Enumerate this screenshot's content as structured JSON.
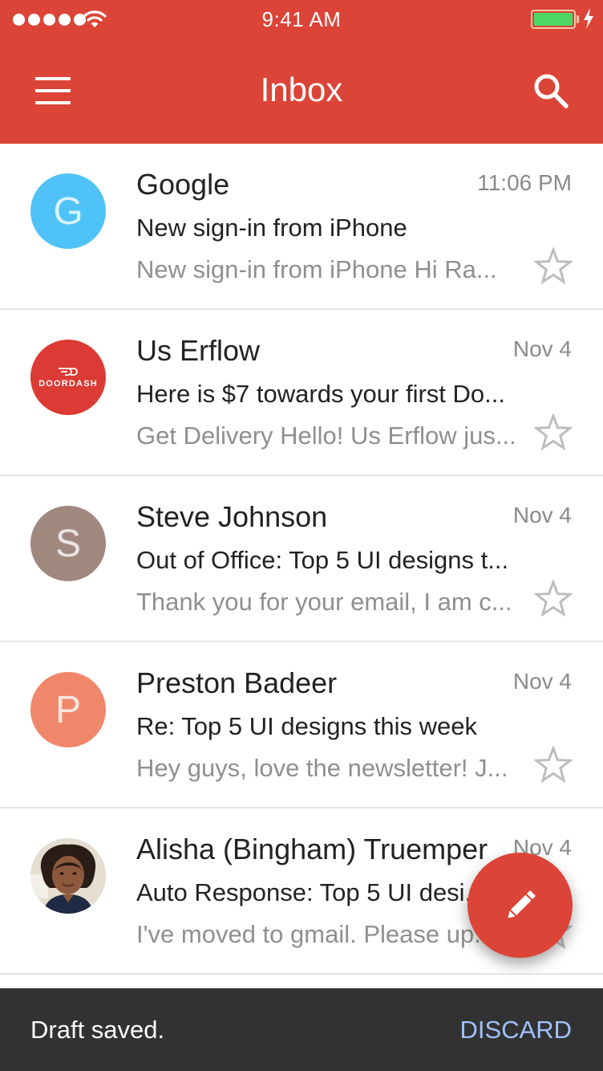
{
  "status_bar": {
    "time": "9:41 AM",
    "signal_bars": 5,
    "wifi": "wifi-icon",
    "battery_level": 1.0,
    "charging": true
  },
  "app_bar": {
    "title": "Inbox",
    "menu_icon": "hamburger-menu-icon",
    "search_icon": "search-icon",
    "background_color": "#db4437"
  },
  "emails": [
    {
      "sender": "Google",
      "date": "11:06 PM",
      "subject": "New sign-in from iPhone",
      "snippet": "New sign-in from iPhone Hi Ra...",
      "avatar_type": "letter",
      "avatar_letter": "G",
      "avatar_color": "#4fc3f7",
      "starred": false
    },
    {
      "sender": "Us Erflow",
      "date": "Nov 4",
      "subject": "Here is $7 towards your first Do...",
      "snippet": "Get Delivery Hello! Us Erflow jus...",
      "avatar_type": "logo",
      "avatar_logo_text": "DOORDASH",
      "avatar_color": "#db3b34",
      "starred": false
    },
    {
      "sender": "Steve Johnson",
      "date": "Nov 4",
      "subject": "Out of Office: Top 5 UI designs t...",
      "snippet": "Thank you for your email, I am c...",
      "avatar_type": "letter",
      "avatar_letter": "S",
      "avatar_color": "#a1887f",
      "starred": false
    },
    {
      "sender": "Preston Badeer",
      "date": "Nov 4",
      "subject": "Re: Top 5 UI designs this week",
      "snippet": "Hey guys, love the newsletter! J...",
      "avatar_type": "letter",
      "avatar_letter": "P",
      "avatar_color": "#f0876a",
      "starred": false
    },
    {
      "sender": "Alisha (Bingham) Truemper",
      "date": "Nov 4",
      "subject": "Auto Response: Top 5 UI desi...",
      "snippet": "I've moved to gmail. Please up...",
      "avatar_type": "photo",
      "starred": false
    }
  ],
  "fab": {
    "icon": "pencil-icon",
    "label": "Compose"
  },
  "snackbar": {
    "message": "Draft saved.",
    "action": "DISCARD",
    "action_color": "#a1c2fa"
  }
}
